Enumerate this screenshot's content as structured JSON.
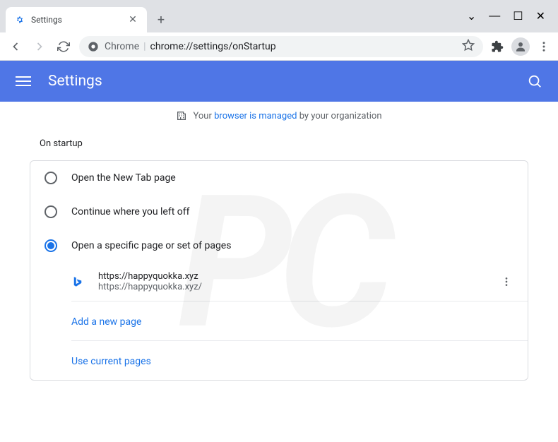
{
  "window": {
    "tab_title": "Settings",
    "chevron": "⌄",
    "min": "—",
    "max": "☐",
    "close": "✕",
    "new_tab": "+",
    "tab_close": "✕"
  },
  "omnibox": {
    "prefix": "Chrome",
    "sep": "|",
    "url": "chrome://settings/onStartup"
  },
  "header": {
    "title": "Settings"
  },
  "managed": {
    "before": "Your",
    "link": "browser is managed",
    "after": "by your organization"
  },
  "section": {
    "title": "On startup"
  },
  "startup": {
    "options": [
      {
        "label": "Open the New Tab page"
      },
      {
        "label": "Continue where you left off"
      },
      {
        "label": "Open a specific page or set of pages"
      }
    ],
    "pages": [
      {
        "title": "https://happyquokka.xyz",
        "url": "https://happyquokka.xyz/"
      }
    ],
    "add_page": "Add a new page",
    "use_current": "Use current pages"
  }
}
